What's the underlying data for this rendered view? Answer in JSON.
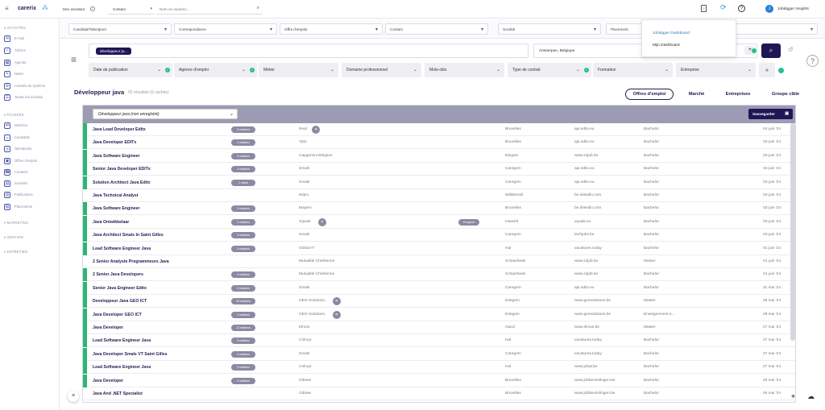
{
  "topbar": {
    "logo": "carerix",
    "assistant_label": "Mon assistant",
    "contact_select": "Contact",
    "search_placeholder": "Nom ou numéro...",
    "user_initial": "J",
    "user_name": "Jobdigger Insights",
    "dropdown_items": [
      "Jobdigger Dashboard",
      "Mijn Dashboard"
    ]
  },
  "filterbar": {
    "fields": [
      "Candidat/Talentpool",
      "Correspondance",
      "Offre d'emploi",
      "Contact",
      "Société",
      "Placement"
    ]
  },
  "sidebar": {
    "activites_header": "ACTIVITÉS",
    "activites": [
      "E-mail",
      "Tâches",
      "Agenda",
      "Notes",
      "Activités du système",
      "Toutes les activités"
    ],
    "fichiers_header": "FICHIERS",
    "fichiers": [
      "Matches",
      "Candidats",
      "Talentpools",
      "Offres d'emploi",
      "Contacts",
      "Sociétés",
      "Publications",
      "Placements"
    ],
    "sections": [
      "MARKETING",
      "GESTION",
      "ENTRETIEN"
    ]
  },
  "search": {
    "tag": "développeur ja...",
    "location": "Antwerpen, Belgique"
  },
  "filters": [
    "Date de publication",
    "Agence d'emploi",
    "Métier",
    "Domaine professionnel",
    "Mots-clés",
    "Type de contrat",
    "Formation",
    "Entreprise"
  ],
  "results": {
    "title": "Développeur java",
    "count_text": "92 résultats (0 cachés)",
    "tabs": [
      "Offres d'emploi",
      "Marché",
      "Entreprises",
      "Groupe cible"
    ],
    "saved_search": "Développeur java (non enregistré)",
    "save_label": "Sauvegarder"
  },
  "rows": [
    {
      "title": "Java Lead Developer Editx",
      "badge": "3 matches",
      "company": "Real",
      "link": true,
      "city": "Bruxelles",
      "site": "api.editx.eu",
      "level": "Bachelor",
      "date": "04 juin '24",
      "flag": "#2bb673"
    },
    {
      "title": "Java Developer EDITx",
      "badge": "4 matches",
      "company": "Ypto",
      "city": "Bruxelles",
      "site": "api.editx.eu",
      "level": "Bachelor",
      "date": "03 juin '24",
      "flag": "#2bb673"
    },
    {
      "title": "Java Software Engineer",
      "badge": "3 matches",
      "company": "Capgemini Belgium",
      "city": "Diegem",
      "site": "www.ictjob.be",
      "level": "Bachelor",
      "date": "03 juin '24",
      "flag": "#2bb673"
    },
    {
      "title": "Senior Java Developer EDITx",
      "badge": "4 matches",
      "company": "Smals",
      "city": "Caregem",
      "site": "api.editx.eu",
      "level": "Bachelor",
      "date": "03 juin '24",
      "flag": "#2bb673"
    },
    {
      "title": "Solution Architect Java Editx",
      "badge": "1 match",
      "company": "Smals",
      "city": "Caregem",
      "site": "api.editx.eu",
      "level": "Bachelor",
      "date": "03 juin '24",
      "flag": "#2bb673"
    },
    {
      "title": "Java Technical Analyst",
      "badge": "",
      "company": "Wipro",
      "city": "Willebroek",
      "site": "be.linkedin.com",
      "level": "Bachelor",
      "date": "03 juin '24",
      "flag": ""
    },
    {
      "title": "Java Software Engineer",
      "badge": "3 matches",
      "company": "Mayten",
      "city": "Bruxelles",
      "site": "be.linkedin.com",
      "level": "Bachelor",
      "date": "03 juin '24",
      "flag": "#2bb673"
    },
    {
      "title": "Java Ontwikkelaar",
      "badge": "3 matches",
      "company": "Xquisit",
      "link": true,
      "prospect": "Prospect",
      "city": "Hasselt",
      "site": "xquisit.eu",
      "level": "Bachelor",
      "date": "03 juin '24",
      "flag": "#2bb673"
    },
    {
      "title": "Java Architect Smals In Saint Gilles",
      "badge": "3 matches",
      "company": "Smals",
      "city": "Caregem",
      "site": "techjobs.be",
      "level": "Bachelor",
      "date": "03 juin '24",
      "flag": "#2bb673"
    },
    {
      "title": "Lead Software Engineer Java",
      "badge": "3 matches",
      "company": "Global IT",
      "city": "Hal",
      "site": "vacatures.today",
      "level": "Bachelor",
      "date": "01 juin '24",
      "flag": "#2bb673"
    },
    {
      "title": "2 Senior Analyste Programmeurs Java",
      "badge": "",
      "company": "Mutualité Chrétienne",
      "city": "Schaerbeek",
      "site": "www.ictjob.be",
      "level": "Master",
      "date": "01 juin '24",
      "flag": ""
    },
    {
      "title": "2 Senior Java Developers",
      "badge": "3 matches",
      "company": "Mutualité Chrétienne",
      "city": "Schaerbeek",
      "site": "www.ictjob.be",
      "level": "Bachelor",
      "date": "01 juin '24",
      "flag": "#2bb673"
    },
    {
      "title": "Senior Java Engineer Editx",
      "badge": "3 matches",
      "company": "Smals",
      "city": "Caregem",
      "site": "api.editx.eu",
      "level": "Bachelor",
      "date": "31 mai '24",
      "flag": "#2bb673"
    },
    {
      "title": "Developpeur Java GEO ICT",
      "badge": "25 matches",
      "company": "GEO Solutions,",
      "link": true,
      "city": "Edegem",
      "site": "www.geosolutions.be",
      "level": "Master",
      "date": "28 mai '24",
      "flag": "#2bb673"
    },
    {
      "title": "Java Developer GEO ICT",
      "badge": "2 matches",
      "company": "GEO Solutions,",
      "link": true,
      "city": "Edegem",
      "site": "www.geosolutions.be",
      "level": "Enseignement s...",
      "date": "28 mai '24",
      "flag": "#2bb673"
    },
    {
      "title": "Java Developer",
      "badge": "12 matches",
      "company": "Elmos",
      "city": "Gand",
      "site": "www.elmos.be",
      "level": "Master",
      "date": "27 mai '24",
      "flag": "#2bb673"
    },
    {
      "title": "Lead Software Engineer Java",
      "badge": "3 matches",
      "company": "Colruyt",
      "city": "Hal",
      "site": "vacatures.today",
      "level": "Bachelor",
      "date": "27 mai '24",
      "flag": "#2bb673"
    },
    {
      "title": "Java Developer Smals VT Saint Gilles",
      "badge": "4 matches",
      "company": "Smals",
      "city": "Caregem",
      "site": "vacatures.today",
      "level": "Bachelor",
      "date": "27 mai '24",
      "flag": "#2bb673"
    },
    {
      "title": "Lead Software Engineer Java",
      "badge": "3 matches",
      "company": "Colruyt",
      "city": "Hal",
      "site": "www.jobat.be",
      "level": "Bachelor",
      "date": "27 mai '24",
      "flag": "#2bb673"
    },
    {
      "title": "Java Developer",
      "badge": "4 matches",
      "company": "Odisee",
      "city": "Bruxelles",
      "site": "www.jobbevindingen.be",
      "level": "Bachelor",
      "date": "26 mai '24",
      "flag": "#2bb673"
    },
    {
      "title": "Java And .NET Specialist",
      "badge": "",
      "company": "Odisee",
      "city": "Bruxelles",
      "site": "www.jobbevindingen.be",
      "level": "Bachelor",
      "date": "26 mai '24",
      "flag": ""
    }
  ]
}
